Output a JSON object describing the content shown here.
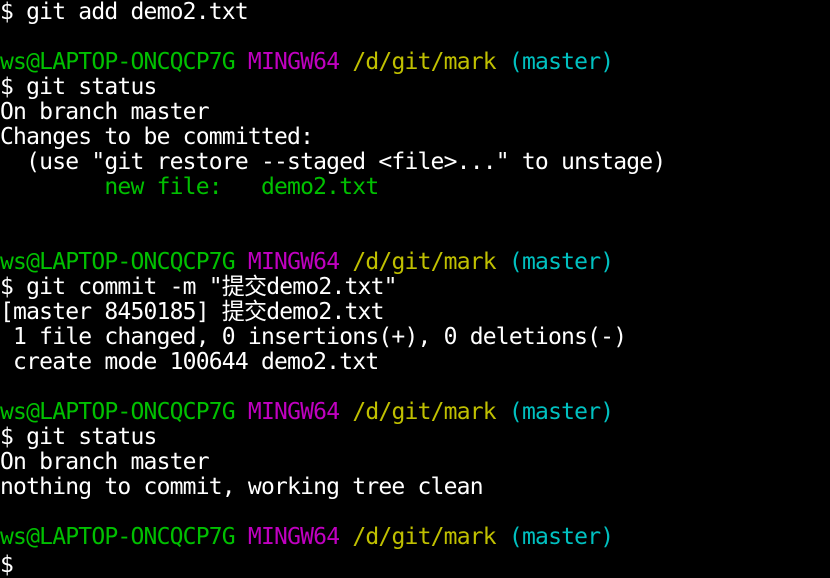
{
  "colors": {
    "background": "#000000",
    "text": "#ffffff",
    "user_host": "#00c000",
    "mingw": "#c000c0",
    "path": "#c0c000",
    "branch": "#00c0c0",
    "staged_file": "#00c000"
  },
  "terminal": {
    "lines": [
      {
        "type": "text",
        "text": "$ git add demo2.txt"
      },
      {
        "type": "blank",
        "text": ""
      },
      {
        "type": "prompt",
        "user": "ws@LAPTOP-ONCQCP7G",
        "env": "MINGW64",
        "path": "/d/git/mark",
        "branch": "(master)"
      },
      {
        "type": "text",
        "text": "$ git status"
      },
      {
        "type": "text",
        "text": "On branch master"
      },
      {
        "type": "text",
        "text": "Changes to be committed:"
      },
      {
        "type": "text",
        "text": "  (use \"git restore --staged <file>...\" to unstage)"
      },
      {
        "type": "green",
        "text": "        new file:   demo2.txt"
      },
      {
        "type": "blank",
        "text": ""
      },
      {
        "type": "blank",
        "text": ""
      },
      {
        "type": "prompt",
        "user": "ws@LAPTOP-ONCQCP7G",
        "env": "MINGW64",
        "path": "/d/git/mark",
        "branch": "(master)"
      },
      {
        "type": "text",
        "text": "$ git commit -m \"提交demo2.txt\""
      },
      {
        "type": "text",
        "text": "[master 8450185] 提交demo2.txt"
      },
      {
        "type": "text",
        "text": " 1 file changed, 0 insertions(+), 0 deletions(-)"
      },
      {
        "type": "text",
        "text": " create mode 100644 demo2.txt"
      },
      {
        "type": "blank",
        "text": ""
      },
      {
        "type": "prompt",
        "user": "ws@LAPTOP-ONCQCP7G",
        "env": "MINGW64",
        "path": "/d/git/mark",
        "branch": "(master)"
      },
      {
        "type": "text",
        "text": "$ git status"
      },
      {
        "type": "text",
        "text": "On branch master"
      },
      {
        "type": "text",
        "text": "nothing to commit, working tree clean"
      },
      {
        "type": "blank",
        "text": ""
      },
      {
        "type": "prompt",
        "user": "ws@LAPTOP-ONCQCP7G",
        "env": "MINGW64",
        "path": "/d/git/mark",
        "branch": "(master)"
      },
      {
        "type": "input",
        "text": "$"
      }
    ]
  }
}
